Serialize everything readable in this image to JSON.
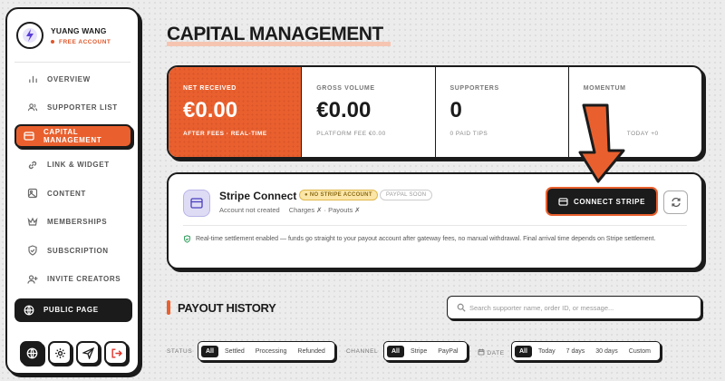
{
  "sidebar": {
    "user_name": "YUANG WANG",
    "plan": "FREE ACCOUNT",
    "items": [
      {
        "label": "OVERVIEW",
        "icon": "bar-chart-icon"
      },
      {
        "label": "SUPPORTER LIST",
        "icon": "users-icon"
      },
      {
        "label": "CAPITAL MANAGEMENT",
        "icon": "credit-card-icon",
        "active": true
      },
      {
        "label": "LINK & WIDGET",
        "icon": "link-icon"
      },
      {
        "label": "CONTENT",
        "icon": "image-icon"
      },
      {
        "label": "MEMBERSHIPS",
        "icon": "crown-icon"
      },
      {
        "label": "SUBSCRIPTION",
        "icon": "shield-check-icon"
      },
      {
        "label": "INVITE CREATORS",
        "icon": "user-plus-icon"
      }
    ],
    "public_page": "PUBLIC PAGE",
    "bottom_buttons": [
      "globe-icon",
      "settings-icon",
      "send-icon",
      "logout-icon"
    ]
  },
  "page_title": "CAPITAL MANAGEMENT",
  "stats": [
    {
      "label": "NET RECEIVED",
      "value": "€0.00",
      "sub": "AFTER FEES · REAL-TIME"
    },
    {
      "label": "GROSS VOLUME",
      "value": "€0.00",
      "sub": "PLATFORM FEE €0.00"
    },
    {
      "label": "SUPPORTERS",
      "value": "0",
      "sub": "0 PAID TIPS"
    },
    {
      "label": "MOMENTUM",
      "value": "",
      "sub": "TODAY +0"
    }
  ],
  "stripe": {
    "name": "Stripe Connect",
    "badge": "NO STRIPE ACCOUNT",
    "soon_badge": "PAYPAL SOON",
    "status": "Account not created",
    "checks": "Charges ✗ · Payouts ✗",
    "connect_label": "CONNECT STRIPE",
    "note": "Real-time settlement enabled — funds go straight to your payout account after gateway fees, no manual withdrawal. Final arrival time depends on Stripe settlement."
  },
  "payout": {
    "title": "PAYOUT HISTORY",
    "search_placeholder": "Search supporter name, order ID, or message...",
    "status_label": "STATUS",
    "status_options": [
      "All",
      "Settled",
      "Processing",
      "Refunded"
    ],
    "channel_label": "CHANNEL",
    "channel_options": [
      "All",
      "Stripe",
      "PayPal"
    ],
    "date_label": "DATE",
    "date_options": [
      "All",
      "Today",
      "7 days",
      "30 days",
      "Custom"
    ]
  },
  "colors": {
    "accent": "#e9602e",
    "ink": "#1b1b1b",
    "warn": "#fbe6a8"
  }
}
